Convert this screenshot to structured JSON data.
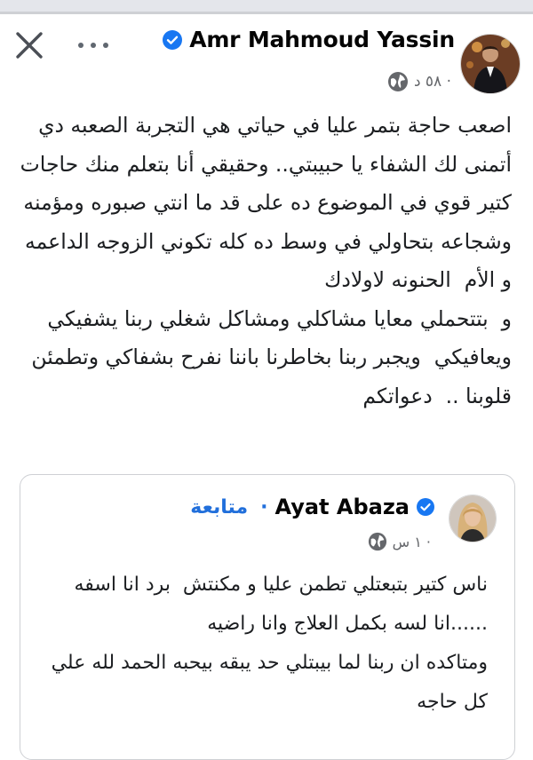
{
  "post": {
    "author_name": "Amr Mahmoud Yassin",
    "time": "٥٨ د ·",
    "icons": {
      "close": "close-icon",
      "more": "more-dots-icon",
      "verified": "verified-badge-icon",
      "privacy": "globe-icon"
    },
    "paragraphs": [
      "اصعب حاجة بتمر عليا في حياتي هي التجربة الصعبه دي أتمنى لك الشفاء يا حبيبتي.. وحقيقي أنا بتعلم منك حاجات كتير قوي في الموضوع ده على قد ما انتي صبوره ومؤمنه وشجاعه بتحاولي في وسط ده كله تكوني الزوجه الداعمه و الأم  الحنونه لاولادك",
      "و  بتتحملي معايا مشاكلي ومشاكل شغلي ربنا يشفيكي ويعافيكي  ويجبر ربنا بخاطرنا باننا نفرح بشفاكي وتطمئن قلوبنا ..  دعواتكم"
    ]
  },
  "shared_post": {
    "author_name": "Ayat Abaza",
    "follow_label": "متابعة",
    "separator": "·",
    "time": "١ س ·",
    "paragraphs": [
      "ناس كتير بتبعتلي تطمن عليا و مكنتش  برد انا اسفه ......انا لسه بكمل العلاج وانا راضيه",
      "ومتاكده ان ربنا لما بيبتلي حد يبقه بيحبه الحمد لله علي كل حاجه"
    ]
  },
  "colors": {
    "link_blue": "#216fdb",
    "verified_blue": "#1877f2",
    "meta_gray": "#65676b"
  }
}
